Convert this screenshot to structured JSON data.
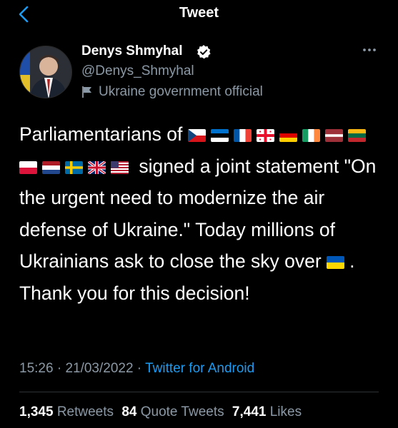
{
  "header": {
    "title": "Tweet"
  },
  "author": {
    "name": "Denys Shmyhal",
    "handle": "@Denys_Shmyhal",
    "label": "Ukraine government official"
  },
  "tweet": {
    "text_start": "Parliamentarians of ",
    "text_mid": " signed a joint statement \"On the urgent need to modernize the air defense of Ukraine.\" Today millions of Ukrainians ask to close the sky over ",
    "text_end": ". Thank you for this decision!",
    "flags_group1": [
      "cz",
      "ee",
      "fr",
      "ge",
      "de",
      "ie"
    ],
    "flags_group2": [
      "lv",
      "lt",
      "pl",
      "nl",
      "se",
      "gb",
      "us"
    ],
    "flag_ua": "ua"
  },
  "meta": {
    "time": "15:26",
    "date": "21/03/2022",
    "source": "Twitter for Android"
  },
  "stats": {
    "retweets_count": "1,345",
    "retweets_label": "Retweets",
    "quotes_count": "84",
    "quotes_label": "Quote Tweets",
    "likes_count": "7,441",
    "likes_label": "Likes"
  },
  "colors": {
    "accent": "#1d9bf0",
    "secondary_text": "#8b98a5",
    "background": "#000000"
  }
}
